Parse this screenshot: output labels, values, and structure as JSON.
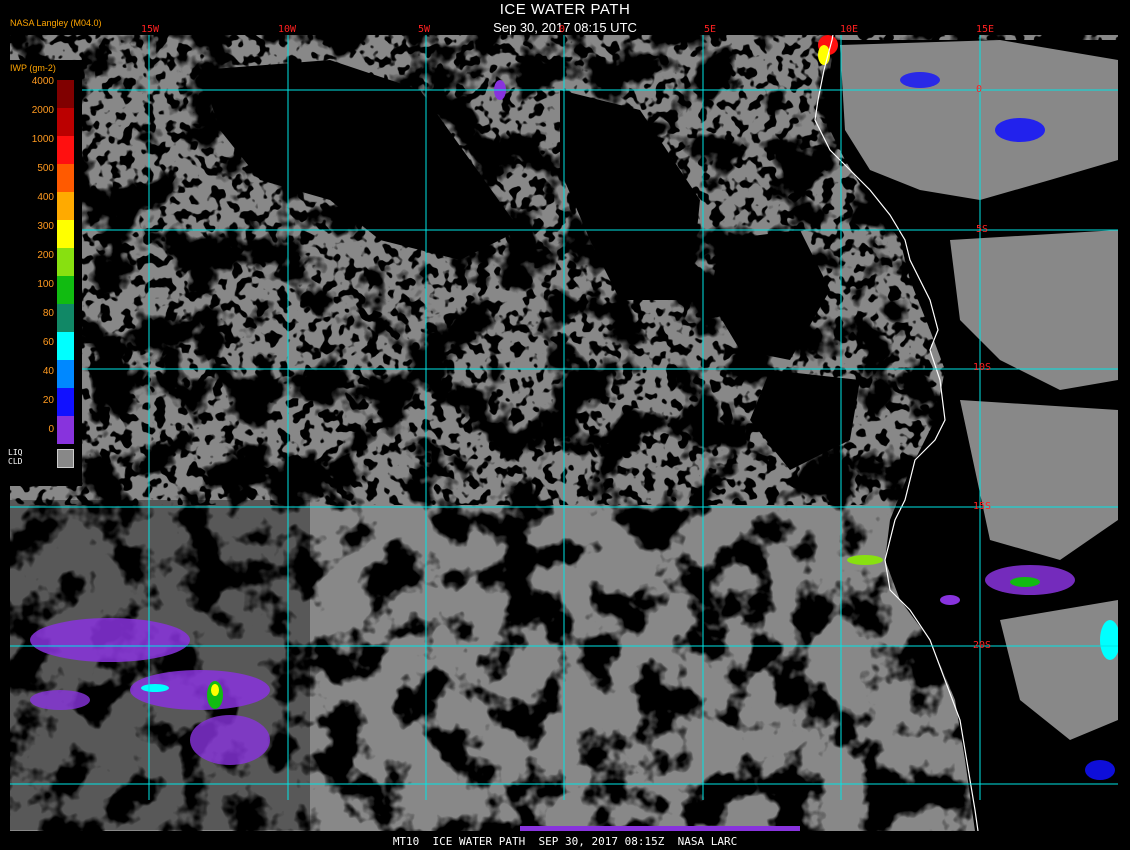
{
  "title": "ICE WATER PATH",
  "subtitle": "Sep 30, 2017 08:15 UTC",
  "provider": "NASA Langley (M04.0)",
  "footer": "MT10  ICE WATER PATH  SEP 30, 2017 08:15Z  NASA LARC",
  "colors": {
    "background": "#000000",
    "liquid_cloud": "#888888",
    "grid": "#00e5e5",
    "grid_label": "#ff2020",
    "coastline": "#ffffff",
    "title": "#ffffff",
    "legend_label": "#ff9a20"
  },
  "grid_lon_labels": [
    "15W",
    "10W",
    "5W",
    "0",
    "5E",
    "10E",
    "15E"
  ],
  "grid_lat_labels": [
    "0",
    "5S",
    "10S",
    "15S",
    "20S"
  ],
  "legend": {
    "title": "IWP (gm-2)",
    "levels": [
      {
        "label": "4000",
        "color": "#800000"
      },
      {
        "label": "2000",
        "color": "#bb0000"
      },
      {
        "label": "1000",
        "color": "#ff1010"
      },
      {
        "label": "500",
        "color": "#ff5a00"
      },
      {
        "label": "400",
        "color": "#ffaa00"
      },
      {
        "label": "300",
        "color": "#ffff00"
      },
      {
        "label": "200",
        "color": "#88e010"
      },
      {
        "label": "100",
        "color": "#11bb11"
      },
      {
        "label": "80",
        "color": "#118866"
      },
      {
        "label": "60",
        "color": "#00ffff"
      },
      {
        "label": "40",
        "color": "#0088ff"
      },
      {
        "label": "20",
        "color": "#1111ff"
      },
      {
        "label": "0",
        "color": "#8833dd"
      }
    ],
    "liquid_cloud_label_1": "LIQ",
    "liquid_cloud_label_2": "CLD"
  }
}
